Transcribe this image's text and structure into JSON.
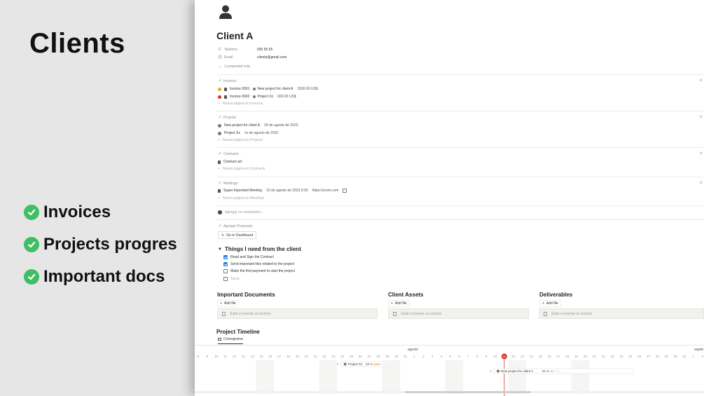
{
  "slide": {
    "title": "Clients",
    "features": [
      "Invoices",
      "Projects progres",
      "Important docs"
    ]
  },
  "page": {
    "title": "Client A",
    "properties": [
      {
        "icon": "phone-icon",
        "label": "Telefono",
        "value": "555 55 55"
      },
      {
        "icon": "at-icon",
        "label": "Email",
        "value": "clienta@gmail.com"
      }
    ],
    "more_props": "1 propiedad más"
  },
  "invoices": {
    "title": "Invoices",
    "rows": [
      {
        "status_color": "#f2a81d",
        "name": "Invoice 0001",
        "project": "New project for client A",
        "amount": "1500.00 US$"
      },
      {
        "status_color": "#d9302c",
        "name": "Invoice 0002",
        "project": "Project Xz",
        "amount": "600.00 US$"
      }
    ],
    "add": "Nueva página en Invoices"
  },
  "projects": {
    "title": "Projects",
    "rows": [
      {
        "name": "New project for client A",
        "date": "24 de agosto de 2023"
      },
      {
        "name": "Project Xz",
        "date": "1e de agosto de 2023"
      }
    ],
    "add": "Nueva página en Projects"
  },
  "contracts": {
    "title": "Contracts",
    "rows": [
      {
        "name": "Contract ad"
      }
    ],
    "add": "Nueva página en Contracts"
  },
  "meetings": {
    "title": "Meetings",
    "rows": [
      {
        "name": "Super Important Meeting",
        "date": "10 de agosto de 2023 9:00",
        "link": "https://zoom.com"
      }
    ],
    "add": "Nueva página en Meetings"
  },
  "comment_placeholder": "Agregar un comentario...",
  "proposals_label": "Agregar Proposals",
  "dashboard_button": "Go to Dashboard",
  "todo": {
    "title": "Things I need from the client",
    "items": [
      {
        "text": "Read and Sign the Contract",
        "checked": true
      },
      {
        "text": "Send important files related to the project",
        "checked": true
      },
      {
        "text": "Make the first payment to start the project",
        "checked": false
      },
      {
        "text": "Tarea",
        "checked": false,
        "placeholder": true
      }
    ]
  },
  "file_columns": [
    {
      "title": "Important Documents",
      "add": "Add file",
      "drop": "Subir o insertar un archivo"
    },
    {
      "title": "Client Assets",
      "add": "Add file",
      "drop": "Subir o insertar un archivo"
    },
    {
      "title": "Deliverables",
      "add": "Add file",
      "drop": "Subir o insertar un archivo"
    }
  ],
  "timeline": {
    "title": "Project Timeline",
    "view_tab": "Cronograma",
    "month_labels": [
      "agosto",
      "septie"
    ],
    "days": [
      "8",
      "9",
      "10",
      "11",
      "12",
      "13",
      "14",
      "15",
      "16",
      "17",
      "18",
      "19",
      "20",
      "21",
      "22",
      "23",
      "24",
      "25",
      "26",
      "27",
      "28",
      "29",
      "30",
      "31",
      "1",
      "2",
      "3",
      "4",
      "5",
      "6",
      "7",
      "8",
      "9",
      "10",
      "11",
      "12",
      "13",
      "14",
      "15",
      "16",
      "17",
      "18",
      "19",
      "20",
      "21",
      "22",
      "23",
      "24",
      "25",
      "26",
      "27",
      "28",
      "29",
      "30",
      "31",
      "1",
      "2"
    ],
    "today_day": "10",
    "bars": [
      {
        "name": "Project Xz",
        "progress": "50 %",
        "progress_value": 0.5
      },
      {
        "name": "New project for client A",
        "progress": "25 %",
        "progress_value": 0.25
      }
    ],
    "accent": "#e0a020",
    "today_color": "#d9302c"
  }
}
